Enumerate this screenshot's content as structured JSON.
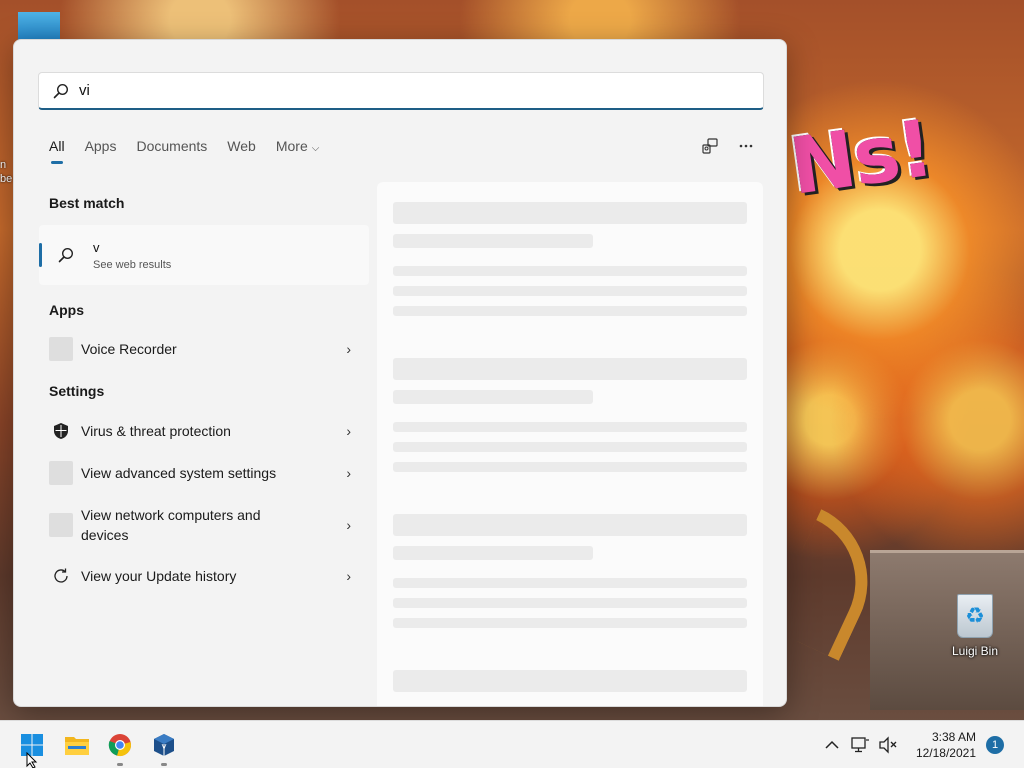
{
  "desktop": {
    "wallpaper_text": "Ns!",
    "left_edge_text": "n be",
    "recycle_bin_label": "Luigi Bin"
  },
  "search": {
    "query": "vi"
  },
  "tabs": [
    {
      "label": "All",
      "active": true
    },
    {
      "label": "Apps"
    },
    {
      "label": "Documents"
    },
    {
      "label": "Web"
    },
    {
      "label": "More"
    }
  ],
  "sections": {
    "best_match": "Best match",
    "apps": "Apps",
    "settings": "Settings"
  },
  "best_match": {
    "query": "v",
    "subtitle": "See web results"
  },
  "apps": [
    {
      "label": "Voice Recorder",
      "icon": "voice-recorder-icon"
    }
  ],
  "settings": [
    {
      "label": "Virus & threat protection",
      "icon": "shield-icon"
    },
    {
      "label": "View advanced system settings",
      "icon": "system-settings-icon"
    },
    {
      "label": "View network computers and devices",
      "icon": "network-icon"
    },
    {
      "label": "View your Update history",
      "icon": "update-icon"
    }
  ],
  "taskbar": {
    "apps": [
      "windows-start-icon",
      "file-explorer-icon",
      "chrome-icon",
      "virtualbox-icon"
    ],
    "time": "3:38 AM",
    "date": "12/18/2021",
    "notification_count": "1"
  },
  "colors": {
    "accent": "#1e6ea6",
    "panel_bg": "#f3f3f3"
  }
}
